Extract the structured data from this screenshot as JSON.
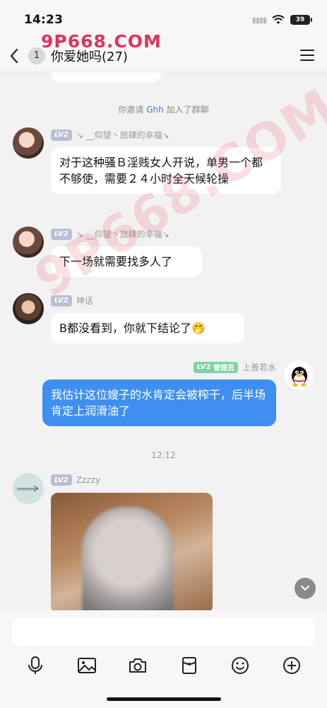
{
  "status_bar": {
    "time": "14:23",
    "battery": "39"
  },
  "watermark": {
    "top": "9P668.COM",
    "diagonal": "9P668.COM"
  },
  "nav": {
    "unread_count": "1",
    "title": "你爱她吗(27)"
  },
  "system_notice": {
    "prefix": "你邀请",
    "user": "Ghh",
    "suffix": "加入了群聊"
  },
  "messages": [
    {
      "level": "LV2",
      "sender": "↘ __仰望丶放肆的幸福↘",
      "text": "对于这种骚Ｂ淫贱女人开说，单男一个都不够使，需要２４小时全天候轮操"
    },
    {
      "level": "LV2",
      "sender": "↘ __仰望丶放肆的幸福↘",
      "text": "下一场就需要找多人了"
    },
    {
      "level": "LV2",
      "sender": "神话",
      "text": "B都没看到，你就下结论了🤭"
    },
    {
      "level": "LV2",
      "role": "管理员",
      "sender": "上善若水",
      "text": "我估计这位嫂子的水肯定会被榨干，后半场肯定上润滑油了"
    },
    {
      "level": "LV2",
      "sender": "Zzzzy",
      "text": ""
    }
  ],
  "time_divider": "12:12",
  "input": {
    "placeholder": ""
  },
  "toolbar": {
    "icons": [
      "microphone-icon",
      "image-icon",
      "camera-icon",
      "red-packet-icon",
      "emoji-icon",
      "plus-icon"
    ]
  }
}
